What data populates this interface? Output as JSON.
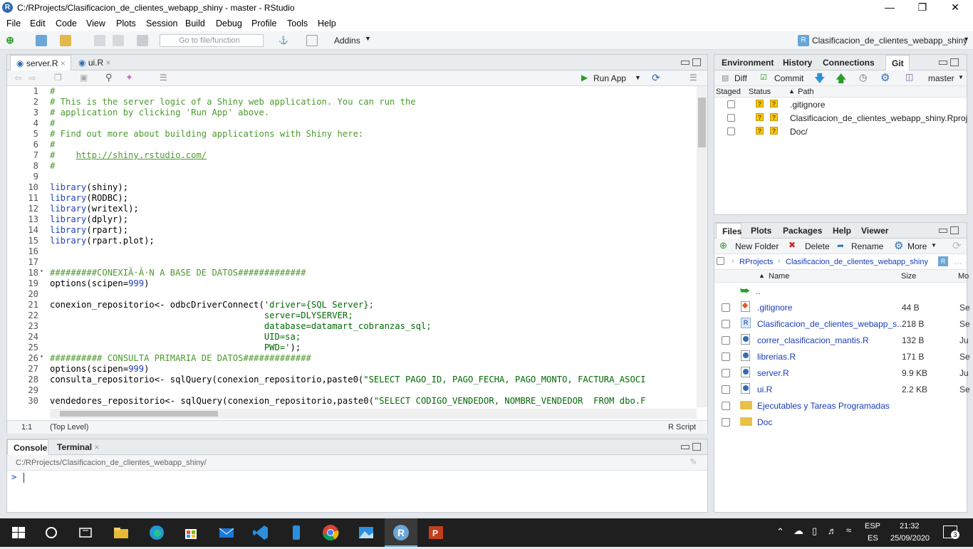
{
  "window": {
    "title": "C:/RProjects/Clasificacion_de_clientes_webapp_shiny - master - RStudio"
  },
  "menu": [
    "File",
    "Edit",
    "Code",
    "View",
    "Plots",
    "Session",
    "Build",
    "Debug",
    "Profile",
    "Tools",
    "Help"
  ],
  "toolbar": {
    "goto_placeholder": "Go to file/function",
    "addins": "Addins",
    "project": "Clasificacion_de_clientes_webapp_shiny"
  },
  "editor": {
    "tabs": [
      "server.R",
      "ui.R"
    ],
    "run_app": "Run App",
    "status_pos": "1:1",
    "status_scope": "(Top Level)",
    "status_type": "R Script",
    "lines": [
      "#",
      "# This is the server logic of a Shiny web application. You can run the",
      "# application by clicking 'Run App' above.",
      "#",
      "# Find out more about building applications with Shiny here:",
      "#",
      "#    http://shiny.rstudio.com/",
      "#",
      "",
      "library(shiny);",
      "library(RODBC);",
      "library(writexl);",
      "library(dplyr);",
      "library(rpart);",
      "library(rpart.plot);",
      "",
      "",
      "#########CONEXIÃ·Â·N A BASE DE DATOS#############",
      "options(scipen=999)",
      "",
      "conexion_repositorio<- odbcDriverConnect('driver={SQL Server};",
      "                                         server=DLYSERVER;",
      "                                         database=datamart_cobranzas_sql;",
      "                                         UID=sa;",
      "                                         PWD=');",
      "########## CONSULTA PRIMARIA DE DATOS#############",
      "options(scipen=999)",
      "consulta_repositorio<- sqlQuery(conexion_repositorio,paste0(\"SELECT PAGO_ID, PAGO_FECHA, PAGO_MONTO, FACTURA_ASOCI",
      "",
      "vendedores_repositorio<- sqlQuery(conexion_repositorio,paste0(\"SELECT CODIGO_VENDEDOR, NOMBRE_VENDEDOR  FROM dbo.F",
      ""
    ]
  },
  "console": {
    "tabs": [
      "Console",
      "Terminal"
    ],
    "path": "C:/RProjects/Clasificacion_de_clientes_webapp_shiny/",
    "prompt": ">"
  },
  "env_pane": {
    "tabs": [
      "Environment",
      "History",
      "Connections",
      "Git"
    ],
    "diff": "Diff",
    "commit": "Commit",
    "branch": "master",
    "cols": [
      "Staged",
      "Status",
      "Path"
    ],
    "rows": [
      ".gitignore",
      "Clasificacion_de_clientes_webapp_shiny.Rproj",
      "Doc/"
    ]
  },
  "files_pane": {
    "tabs": [
      "Files",
      "Plots",
      "Packages",
      "Help",
      "Viewer"
    ],
    "new_folder": "New Folder",
    "delete": "Delete",
    "rename": "Rename",
    "more": "More",
    "crumbs": [
      "RProjects",
      "Clasificacion_de_clientes_webapp_shiny"
    ],
    "cols": [
      "Name",
      "Size",
      "Mo"
    ],
    "up": "..",
    "files": [
      {
        "name": ".gitignore",
        "size": "44 B",
        "mod": "Se",
        "icon": "git-file-icon"
      },
      {
        "name": "Clasificacion_de_clientes_webapp_s...",
        "size": "218 B",
        "mod": "Se",
        "icon": "rproj-icon"
      },
      {
        "name": "correr_clasificacion_mantis.R",
        "size": "132 B",
        "mod": "Ju",
        "icon": "r-file-icon"
      },
      {
        "name": "librerias.R",
        "size": "171 B",
        "mod": "Se",
        "icon": "r-file-icon"
      },
      {
        "name": "server.R",
        "size": "9.9 KB",
        "mod": "Ju",
        "icon": "r-file-icon"
      },
      {
        "name": "ui.R",
        "size": "2.2 KB",
        "mod": "Se",
        "icon": "r-file-icon"
      },
      {
        "name": "Ejecutables y Tareas Programadas",
        "size": "",
        "mod": "",
        "icon": "folder-icon"
      },
      {
        "name": "Doc",
        "size": "",
        "mod": "",
        "icon": "folder-icon"
      }
    ]
  },
  "taskbar": {
    "lang1": "ESP",
    "lang2": "ES",
    "time": "21:32",
    "date": "25/09/2020",
    "notif": "3"
  }
}
